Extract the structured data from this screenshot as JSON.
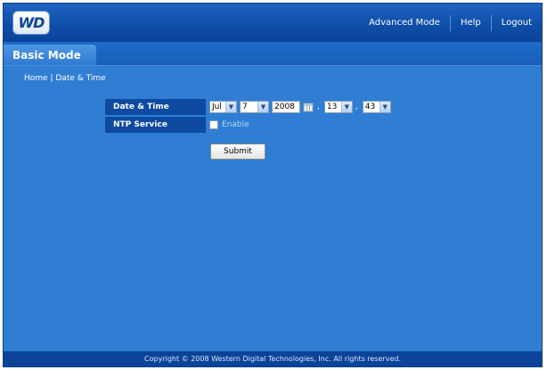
{
  "header": {
    "logo_text": "WD",
    "nav": {
      "advanced_mode": "Advanced Mode",
      "help": "Help",
      "logout": "Logout"
    }
  },
  "mode_tab": "Basic Mode",
  "breadcrumb": {
    "home": "Home",
    "separator": "|",
    "current": "Date & Time"
  },
  "form": {
    "date_time_label": "Date & Time",
    "month": "Jul",
    "day": "7",
    "year": "2008",
    "hour": "13",
    "minute": "43",
    "time_separator": ",",
    "ntp_label": "NTP Service",
    "ntp_enable_label": "Enable",
    "ntp_enabled": false,
    "submit_label": "Submit"
  },
  "footer": {
    "copyright": "Copyright © 2008 Western Digital Technologies, Inc. All rights reserved."
  },
  "colors": {
    "background": "#2f7ed3",
    "header": "#0e4ea8",
    "label_cell": "#0d4aa0",
    "footer": "#0b4399"
  },
  "icons": {
    "calendar": "calendar-icon",
    "dropdown": "chevron-down-icon"
  }
}
